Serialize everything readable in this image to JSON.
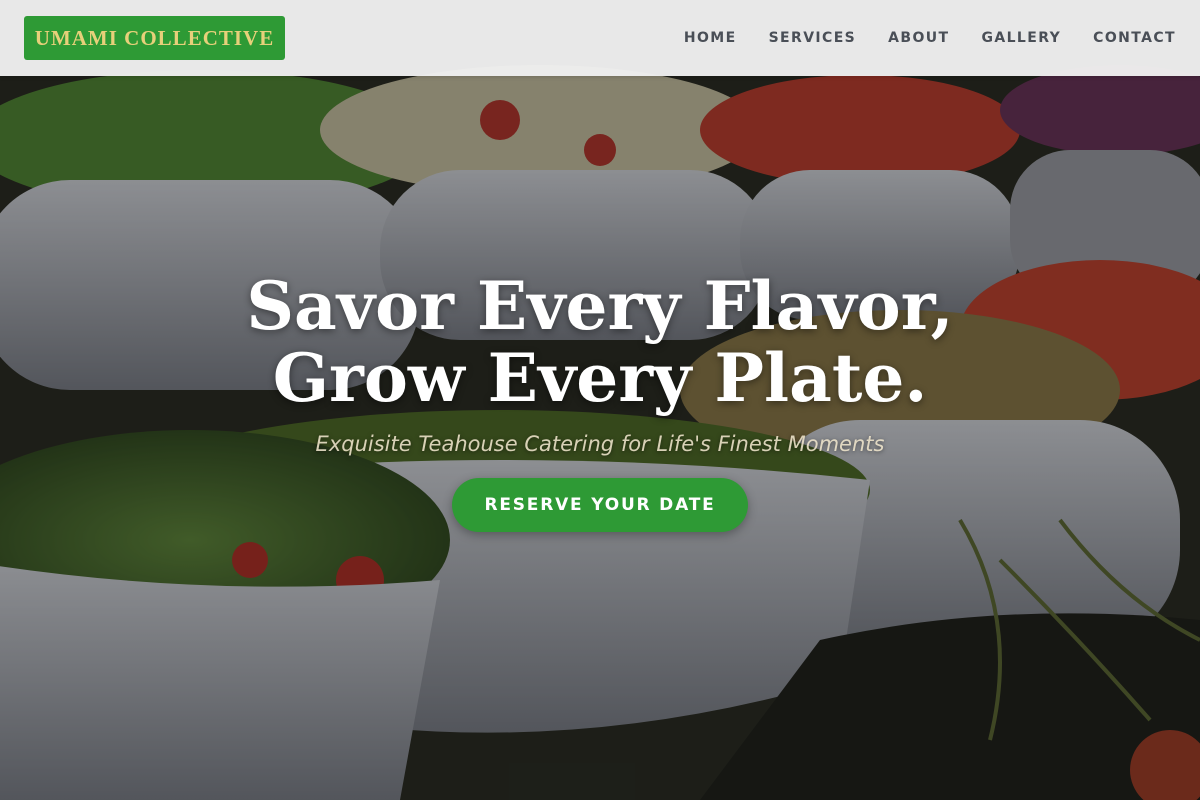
{
  "brand": {
    "name": "UMAMI COLLECTIVE"
  },
  "nav": {
    "items": [
      {
        "label": "HOME"
      },
      {
        "label": "SERVICES"
      },
      {
        "label": "ABOUT"
      },
      {
        "label": "GALLERY"
      },
      {
        "label": "CONTACT"
      }
    ]
  },
  "hero": {
    "title_line1": "Savor Every Flavor,",
    "title_line2": "Grow Every Plate.",
    "subtitle": "Exquisite Teahouse Catering for Life's Finest Moments",
    "cta_label": "RESERVE YOUR DATE",
    "background_description_icon": "salad-bowls-photo"
  },
  "colors": {
    "brand_green": "#2e9a35",
    "logo_text": "#e7d07a",
    "nav_bg": "#f0f0f0",
    "nav_text": "#4a4f57"
  }
}
